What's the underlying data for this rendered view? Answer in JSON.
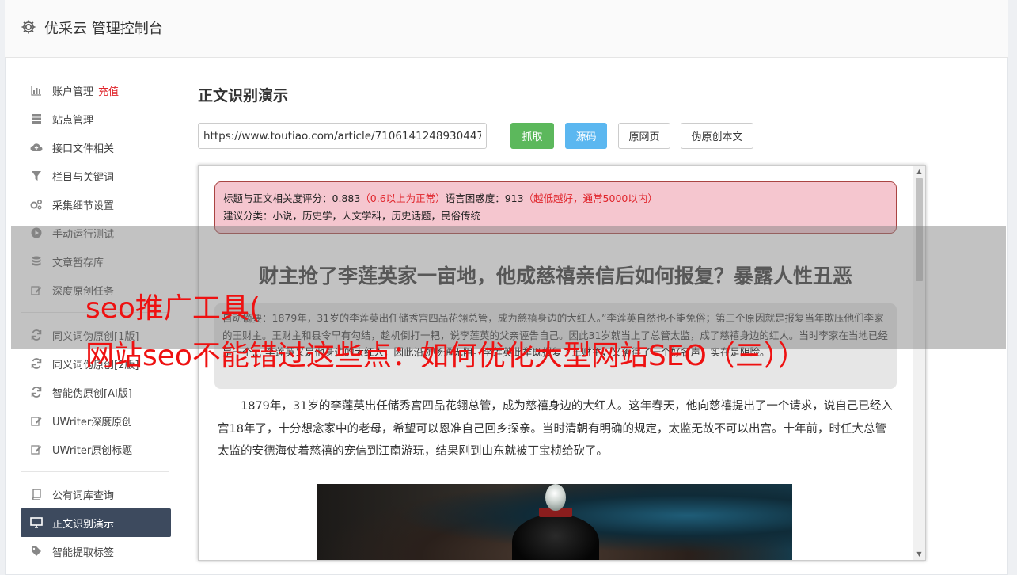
{
  "header": {
    "title": "优采云 管理控制台",
    "icon": "gear-icon"
  },
  "sidebar": {
    "items": [
      {
        "label": "账户管理",
        "badge": "充值",
        "icon": "bar-chart-icon"
      },
      {
        "label": "站点管理",
        "icon": "server-icon"
      },
      {
        "label": "接口文件相关",
        "icon": "cloud-upload-icon"
      },
      {
        "label": "栏目与关键词",
        "icon": "filter-icon"
      },
      {
        "label": "采集细节设置",
        "icon": "cogs-icon"
      },
      {
        "label": "手动运行测试",
        "icon": "play-circle-icon"
      },
      {
        "label": "文章暂存库",
        "icon": "database-icon"
      },
      {
        "label": "深度原创任务",
        "icon": "edit-icon"
      },
      {
        "label": "同义词伪原创[1版]",
        "icon": "refresh-icon"
      },
      {
        "label": "同义词伪原创[2版]",
        "icon": "refresh-icon"
      },
      {
        "label": "智能伪原创[AI版]",
        "icon": "refresh-icon"
      },
      {
        "label": "UWriter深度原创",
        "icon": "edit-icon"
      },
      {
        "label": "UWriter原创标题",
        "icon": "edit-icon"
      },
      {
        "label": "公有词库查询",
        "icon": "book-icon"
      },
      {
        "label": "正文识别演示",
        "icon": "desktop-icon"
      },
      {
        "label": "智能提取标签",
        "icon": "tag-icon"
      }
    ]
  },
  "main": {
    "title": "正文识别演示",
    "url_value": "https://www.toutiao.com/article/7106141248930447",
    "buttons": {
      "fetch": "抓取",
      "source": "源码",
      "original": "原网页",
      "pseudo": "伪原创本文"
    }
  },
  "preview": {
    "alert_line1_a": "标题与正文相关度评分：0.883",
    "alert_line1_b": "（0.6以上为正常）",
    "alert_line1_c": "语言困惑度：913",
    "alert_line1_d": "（越低越好，通常5000以内）",
    "alert_line2": "建议分类：小说，历史学，人文学科，历史话题，民俗传统",
    "article_title": "财主抢了李莲英家一亩地，他成慈禧亲信后如何报复？暴露人性丑恶",
    "summary": "自动摘要：1879年，31岁的李莲英出任储秀宫四品花翎总管，成为慈禧身边的大红人。”李莲英自然也不能免俗；第三个原因就是报复当年欺压他们李家的王财主。王财主和县令早有勾结，趁机倒打一耙，说李莲英的父亲诬告自己。因此31岁就当上了总管太监，成了慈禧身边的红人。当时李家在当地已经是一个… 李莲英又是他身边的大红人，因此沿途畅通无阻。李莲英此举既报复了王财主，又落得了一个好名声，实在是阴险。",
    "paragraph": "1879年，31岁的李莲英出任储秀宫四品花翎总管，成为慈禧身边的大红人。这年春天，他向慈禧提出了一个请求，说自己已经入宫18年了，十分想念家中的老母，希望可以恩准自己回乡探亲。当时清朝有明确的规定，太监无故不可以出宫。十年前，时任大总管太监的安德海仗着慈禧的宠信到江南游玩，结果刚到山东就被丁宝桢给砍了。"
  },
  "watermark": {
    "line1": "seo推广工具(",
    "line2": "网站seo不能错过这些点：如何优化大型网站SEO（三））"
  }
}
